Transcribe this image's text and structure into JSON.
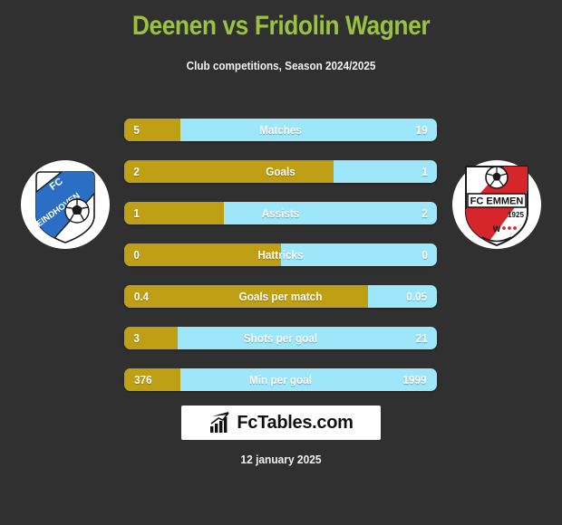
{
  "theme": {
    "background": "#303030",
    "title_color": "#9ac13f",
    "home_bar_color": "#bfa015",
    "away_bar_color": "#9ee7fa",
    "text_color": "#ffffff"
  },
  "header": {
    "title": "Deenen vs Fridolin Wagner",
    "subtitle": "Club competitions, Season 2024/2025"
  },
  "crests": {
    "home": {
      "name": "FC Eindhoven",
      "line1": "FC",
      "line2": "EINDHOVEN",
      "icon": "fc-eindhoven-crest"
    },
    "away": {
      "name": "FC Emmen",
      "line1": "FC EMMEN",
      "line2": "1925",
      "icon": "fc-emmen-crest"
    }
  },
  "chart_data": {
    "type": "bar",
    "title": "Deenen vs Fridolin Wagner",
    "subtitle": "Club competitions, Season 2024/2025",
    "orientation": "horizontal-diverging",
    "series": [
      {
        "name": "Deenen",
        "color": "#bfa015"
      },
      {
        "name": "Fridolin Wagner",
        "color": "#9ee7fa"
      }
    ],
    "categories": [
      "Matches",
      "Goals",
      "Assists",
      "Hattricks",
      "Goals per match",
      "Shots per goal",
      "Min per goal"
    ],
    "rows": [
      {
        "label": "Matches",
        "home": "5",
        "away": "19",
        "home_pct": 18
      },
      {
        "label": "Goals",
        "home": "2",
        "away": "1",
        "home_pct": 67
      },
      {
        "label": "Assists",
        "home": "1",
        "away": "2",
        "home_pct": 32
      },
      {
        "label": "Hattricks",
        "home": "0",
        "away": "0",
        "home_pct": 50
      },
      {
        "label": "Goals per match",
        "home": "0.4",
        "away": "0.05",
        "home_pct": 78
      },
      {
        "label": "Shots per goal",
        "home": "3",
        "away": "21",
        "home_pct": 17
      },
      {
        "label": "Min per goal",
        "home": "376",
        "away": "1999",
        "home_pct": 18
      }
    ]
  },
  "footer": {
    "brand": "FcTables.com",
    "brand_icon": "bar-chart-icon",
    "date": "12 january 2025"
  }
}
